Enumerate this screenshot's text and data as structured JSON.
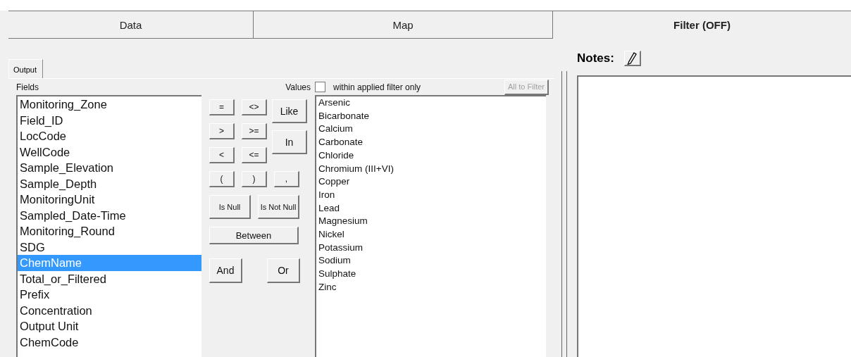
{
  "tabs": [
    {
      "label": "Data",
      "selected": false
    },
    {
      "label": "Map",
      "selected": false
    },
    {
      "label": "Filter (OFF)",
      "selected": true
    }
  ],
  "sub_tabs": [
    {
      "label": "Output",
      "selected": true
    }
  ],
  "fields": {
    "label": "Fields",
    "items": [
      {
        "label": "Monitoring_Zone",
        "selected": false
      },
      {
        "label": "Field_ID",
        "selected": false
      },
      {
        "label": "LocCode",
        "selected": false
      },
      {
        "label": "WellCode",
        "selected": false
      },
      {
        "label": "Sample_Elevation",
        "selected": false
      },
      {
        "label": "Sample_Depth",
        "selected": false
      },
      {
        "label": "MonitoringUnit",
        "selected": false
      },
      {
        "label": "Sampled_Date-Time",
        "selected": false
      },
      {
        "label": "Monitoring_Round",
        "selected": false
      },
      {
        "label": "SDG",
        "selected": false
      },
      {
        "label": "ChemName",
        "selected": true
      },
      {
        "label": "Total_or_Filtered",
        "selected": false
      },
      {
        "label": "Prefix",
        "selected": false
      },
      {
        "label": "Concentration",
        "selected": false
      },
      {
        "label": "Output Unit",
        "selected": false
      },
      {
        "label": "ChemCode",
        "selected": false
      }
    ]
  },
  "operator_rows": [
    [
      {
        "label": "=",
        "kind": "small"
      },
      {
        "label": "<>",
        "kind": "small"
      },
      {
        "label": "Like",
        "kind": "tall"
      }
    ],
    [
      {
        "label": ">",
        "kind": "small"
      },
      {
        "label": ">=",
        "kind": "small"
      },
      {
        "label": "In",
        "kind": "tall"
      }
    ],
    [
      {
        "label": "<",
        "kind": "small"
      },
      {
        "label": "<=",
        "kind": "small"
      }
    ],
    [
      {
        "label": "(",
        "kind": "small"
      },
      {
        "label": ")",
        "kind": "small"
      },
      {
        "label": ",",
        "kind": "small"
      }
    ],
    [
      {
        "label": "Is Null",
        "kind": "medium"
      },
      {
        "label": "Is Not Null",
        "kind": "medium"
      }
    ],
    [
      {
        "label": "Between",
        "kind": "wide"
      }
    ],
    [
      {
        "label": "And",
        "kind": "logic"
      },
      {
        "label": "Or",
        "kind": "logic"
      }
    ]
  ],
  "values": {
    "label": "Values",
    "filter_checkbox": {
      "label": "within applied filter only",
      "checked": false
    },
    "all_to_filter": {
      "label": "All to Filter",
      "disabled": true
    },
    "items": [
      "Arsenic",
      "Bicarbonate",
      "Calcium",
      "Carbonate",
      "Chloride",
      "Chromium (III+VI)",
      "Copper",
      "Iron",
      "Lead",
      "Magnesium",
      "Nickel",
      "Potassium",
      "Sodium",
      "Sulphate",
      "Zinc"
    ]
  },
  "notes": {
    "label": "Notes:"
  }
}
